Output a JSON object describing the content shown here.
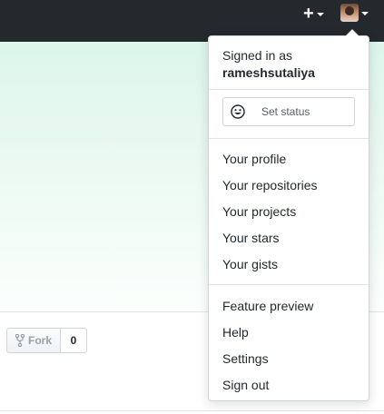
{
  "header": {
    "new_icon": "plus-icon",
    "user_icon": "avatar"
  },
  "dropdown": {
    "signed_in_label": "Signed in as",
    "username": "rameshsutaliya",
    "status_label": "Set status",
    "status_icon": "smiley-icon",
    "section_one": [
      "Your profile",
      "Your repositories",
      "Your projects",
      "Your stars",
      "Your gists"
    ],
    "section_two": [
      "Feature preview",
      "Help",
      "Settings",
      "Sign out"
    ]
  },
  "repo_actions": {
    "fork_label": "Fork",
    "fork_icon": "fork-icon",
    "fork_count": "0"
  },
  "colors": {
    "header_bg": "#24292e",
    "text": "#24292e",
    "muted": "#586069",
    "border": "#d1d5da",
    "hero_top": "#dcf6ec"
  }
}
